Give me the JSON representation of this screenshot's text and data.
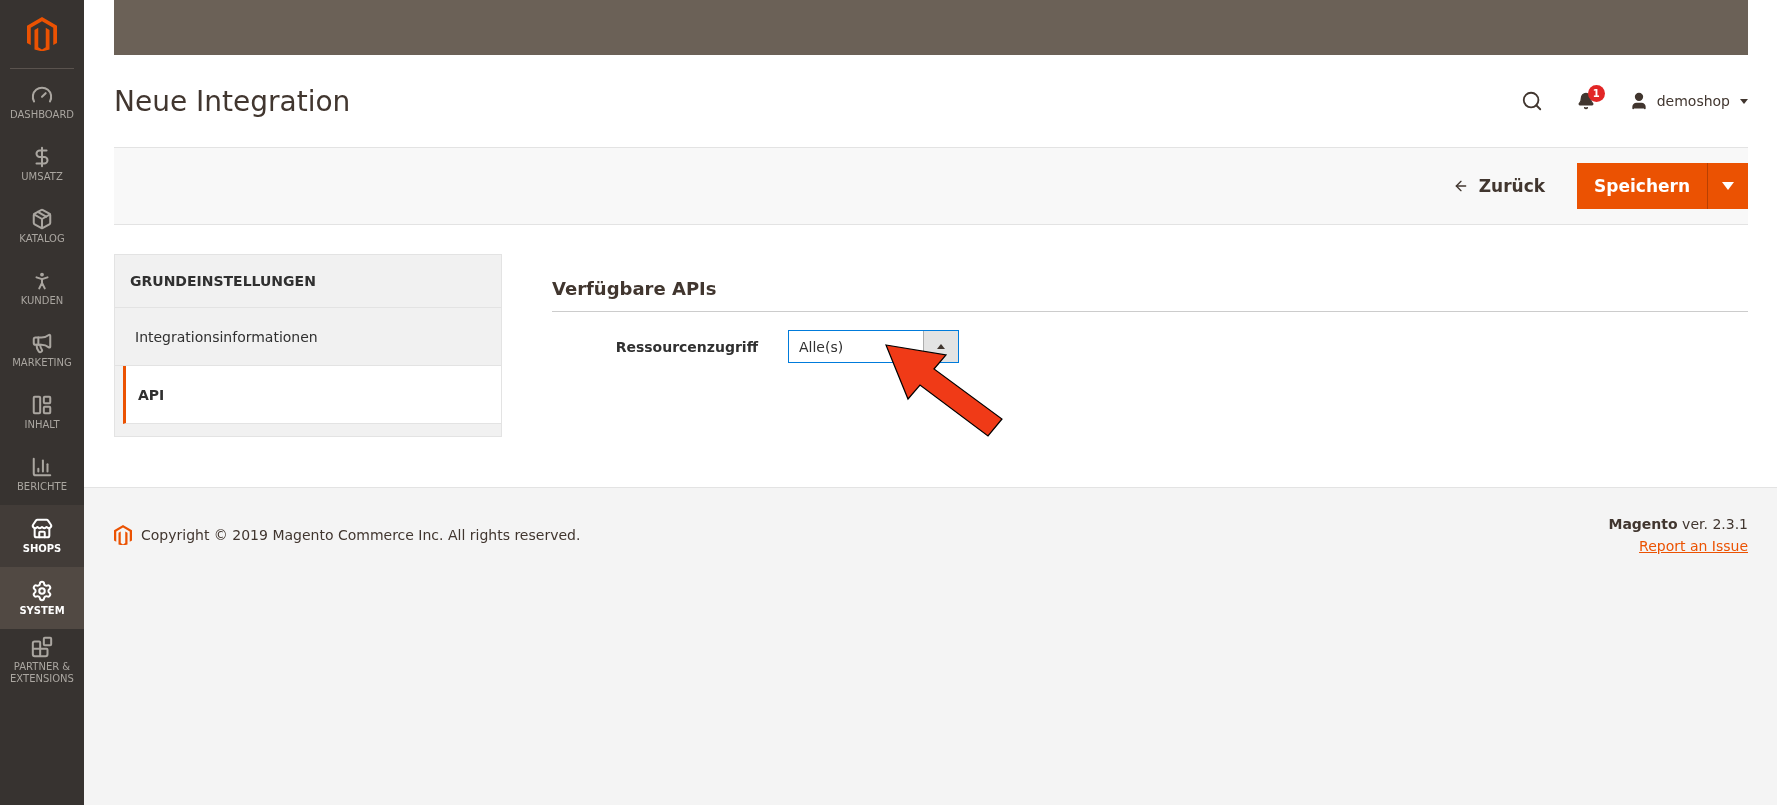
{
  "sidebar": {
    "items": [
      {
        "label": "DASHBOARD",
        "selected": false,
        "hovered": false
      },
      {
        "label": "UMSATZ",
        "selected": false,
        "hovered": false
      },
      {
        "label": "KATALOG",
        "selected": false,
        "hovered": false
      },
      {
        "label": "KUNDEN",
        "selected": false,
        "hovered": false
      },
      {
        "label": "MARKETING",
        "selected": false,
        "hovered": false
      },
      {
        "label": "INHALT",
        "selected": false,
        "hovered": false
      },
      {
        "label": "BERICHTE",
        "selected": false,
        "hovered": false
      },
      {
        "label": "SHOPS",
        "selected": false,
        "hovered": true
      },
      {
        "label": "SYSTEM",
        "selected": true,
        "hovered": false
      },
      {
        "label": "PARTNER & EXTENSIONS",
        "selected": false,
        "hovered": false
      }
    ]
  },
  "header": {
    "title": "Neue Integration",
    "notifications": "1",
    "user": "demoshop"
  },
  "actions": {
    "back": "Zurück",
    "save": "Speichern"
  },
  "tabs": {
    "heading": "GRUNDEINSTELLUNGEN",
    "items": [
      {
        "label": "Integrationsinformationen",
        "selected": false
      },
      {
        "label": "API",
        "selected": true
      }
    ]
  },
  "section": {
    "title": "Verfügbare APIs",
    "field_label": "Ressourcenzugriff",
    "value": "Alle(s)"
  },
  "footer": {
    "copyright": "Copyright © 2019 Magento Commerce Inc. All rights reserved.",
    "version": "**Magento** ver. 2.3.1",
    "report_link": "Report an Issue"
  }
}
